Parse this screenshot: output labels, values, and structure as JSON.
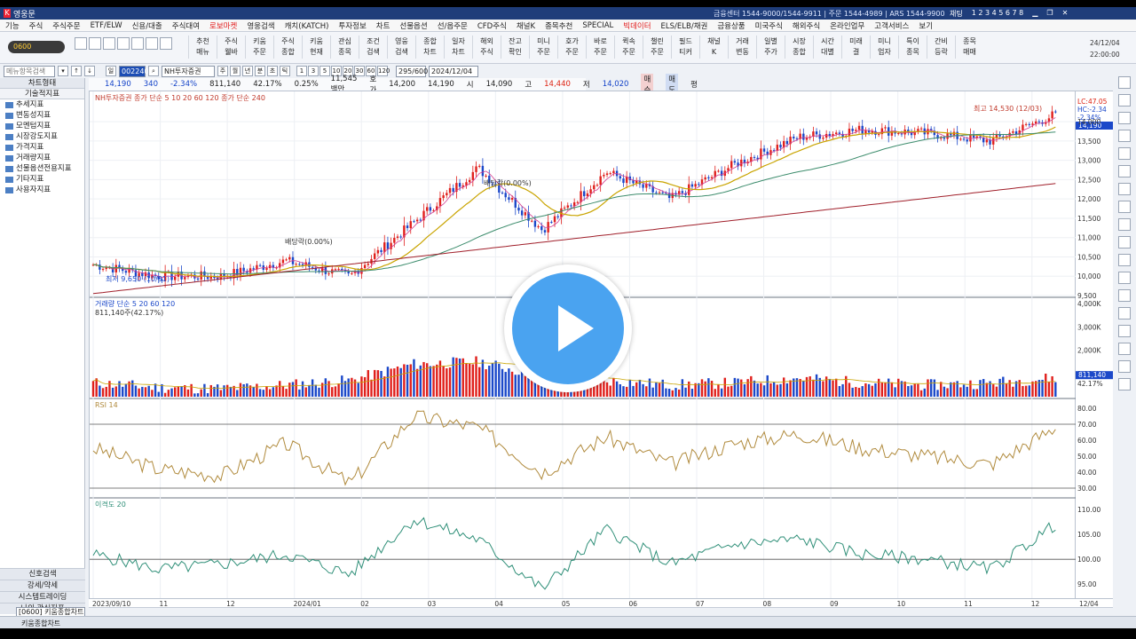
{
  "window": {
    "title": "영웅문",
    "center_info": "금융센터 1544-9000/1544-9911 | 주문 1544-4989 | ARS 1544-9900",
    "user": "채팅",
    "screen_numbers": "1 2 3 4 5 6 7 8"
  },
  "menu": [
    "기능",
    "주식",
    "주식주문",
    "ETF/ELW",
    "신용/대출",
    "주식대여",
    "로보마켓",
    "영웅검색",
    "캐치(KATCH)",
    "투자정보",
    "차트",
    "선물옵션",
    "선/옵주문",
    "CFD주식",
    "채널K",
    "종목추천",
    "SPECIAL",
    "빅데이터",
    "ELS/ELB/채권",
    "금융상품",
    "미국주식",
    "해외주식",
    "온라인업무",
    "고객서비스",
    "보기"
  ],
  "menu_highlights": [
    "로보마켓",
    "빅데이터"
  ],
  "toolbar": {
    "code": "0600",
    "buttons": [
      "추천\n매뉴",
      "주식\n웰바",
      "키움\n주문",
      "주식\n종합",
      "키움\n현재",
      "관심\n종목",
      "조건\n검색",
      "영웅\n검색",
      "종합\n차트",
      "일자\n차트",
      "해외\n주식",
      "잔고\n확인",
      "미니\n주문",
      "호가\n주문",
      "바로\n주문",
      "퀵속\n주문",
      "챌린\n주문",
      "필드\n티커",
      "채널\nK",
      "거래\n변동",
      "일별\n주가",
      "시장\n종합",
      "시간\n대별",
      "미래\n결",
      "미니\n업자",
      "특이\n종목",
      "간비\n등락",
      "종목\n매매"
    ],
    "date": "24/12/04",
    "time": "22:00:00"
  },
  "chart_header": {
    "search_placeholder": "메뉴항목검색",
    "period_options": [
      "주",
      "월",
      "년",
      "분",
      "초",
      "틱"
    ],
    "selected_period": "일",
    "stock_code": "002240",
    "stock_name": "NH투자증권",
    "count": "295/600",
    "date": "2024/12/04",
    "minute_buttons": [
      "1",
      "3",
      "5",
      "10",
      "20",
      "30",
      "60",
      "120"
    ]
  },
  "price_bar": {
    "price": "14,190",
    "change": "340",
    "change_pct": "-2.34%",
    "volume": "811,140",
    "vol_pct": "42.17%",
    "turnover": "0.25%",
    "amount": "11,545백만",
    "ask_label": "호가",
    "ask": "14,200",
    "bid": "14,190",
    "open_label": "시",
    "open": "14,090",
    "high_label": "고",
    "high": "14,440",
    "low_label": "저",
    "low": "14,020",
    "buy": "매수",
    "sell": "매도",
    "eval": "평"
  },
  "sidebar": {
    "tab": "차트형태",
    "section": "기술적지표",
    "items": [
      "추세지표",
      "변동성지표",
      "모멘텀지표",
      "시장강도지표",
      "가격지표",
      "거래량지표",
      "선물옵션전용지표",
      "기타지표",
      "사용자지표"
    ],
    "bottom": [
      "신호검색",
      "강세/약세",
      "시스템트레이딩",
      "나의 관심지표"
    ]
  },
  "chart_labels": {
    "main_legend": "NH투자증권  종가 단순 5  10  20  60  120  종가 단순 240",
    "high_label": "최고 14,530 (12/03)",
    "low_label": "최저 9,650 (10/31)",
    "dividend1": "배당락(0.00%)",
    "dividend2": "배당락(0.00%)",
    "volume_legend": "거래량  단순 5  20  60  120",
    "volume_value": "811,140주(42.17%)",
    "rsi_legend": "RSI 14",
    "disparity_legend": "이격도 20",
    "lc": "LC:47.05",
    "hc": "HC:-2.34",
    "pct": "-2.34%",
    "price_tag": "14,190",
    "vol_tag": "811,140",
    "vol_pct_tag": "42.17%"
  },
  "axes": {
    "price_ticks": [
      "14,000",
      "13,500",
      "13,000",
      "12,500",
      "12,000",
      "11,500",
      "11,000",
      "10,500",
      "10,000",
      "9,500"
    ],
    "volume_ticks": [
      "4,000K",
      "3,000K",
      "2,000K",
      "1,000K"
    ],
    "rsi_ticks": [
      "80.00",
      "70.00",
      "60.00",
      "50.00",
      "40.00",
      "30.00"
    ],
    "disparity_ticks": [
      "110.00",
      "105.00",
      "100.00",
      "95.00"
    ],
    "date_ticks": [
      "2023/09/10",
      "11",
      "12",
      "2024/01",
      "02",
      "03",
      "04",
      "05",
      "06",
      "07",
      "08",
      "09",
      "10",
      "11",
      "12",
      "12/04"
    ]
  },
  "taskbar": {
    "item": "[0600] 키움종합차트",
    "caption": "키움종합차트"
  },
  "chart_data": {
    "type": "line",
    "title": "NH투자증권",
    "x": [
      "2023/09",
      "2023/10",
      "2023/11",
      "2023/12",
      "2024/01",
      "2024/02",
      "2024/03",
      "2024/04",
      "2024/05",
      "2024/06",
      "2024/07",
      "2024/08",
      "2024/09",
      "2024/10",
      "2024/11",
      "2024/12"
    ],
    "series": [
      {
        "name": "종가",
        "values": [
          10300,
          10000,
          10000,
          10400,
          10000,
          11400,
          12800,
          11200,
          12700,
          12000,
          12900,
          13600,
          13800,
          13700,
          13500,
          14190
        ]
      },
      {
        "name": "거래량",
        "values": [
          600,
          400,
          350,
          500,
          700,
          1400,
          1500,
          900,
          700,
          500,
          600,
          800,
          600,
          500,
          600,
          811
        ]
      },
      {
        "name": "RSI 14",
        "values": [
          55,
          42,
          38,
          58,
          33,
          75,
          68,
          40,
          62,
          45,
          58,
          64,
          55,
          50,
          45,
          68
        ]
      },
      {
        "name": "이격도 20",
        "values": [
          101,
          98,
          99,
          101,
          97,
          108,
          104,
          94,
          106,
          99,
          103,
          104,
          101,
          100,
          98,
          107
        ]
      }
    ],
    "ylim": [
      9500,
      14600
    ]
  }
}
